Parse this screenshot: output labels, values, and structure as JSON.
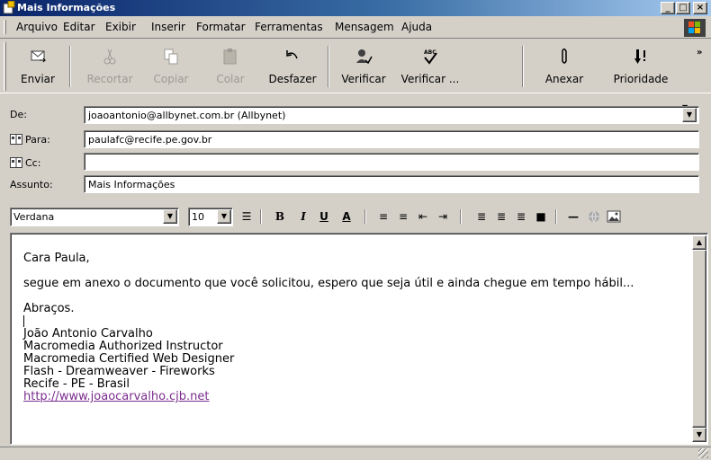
{
  "window": {
    "title": "Mais Informações",
    "controls": {
      "minimize": "_",
      "maximize": "□",
      "close": "×"
    }
  },
  "menu": [
    "Arquivo",
    "Editar",
    "Exibir",
    "Inserir",
    "Formatar",
    "Ferramentas",
    "Mensagem",
    "Ajuda"
  ],
  "toolbar": {
    "send": "Enviar",
    "cut": "Recortar",
    "copy": "Copiar",
    "paste": "Colar",
    "undo": "Desfazer",
    "check_names": "Verificar",
    "spelling": "Verificar ...",
    "attach": "Anexar",
    "priority": "Prioridade",
    "more": "»"
  },
  "header": {
    "from_label": "De:",
    "from_value": "joaoantonio@allbynet.com.br    (Allbynet)",
    "to_label": "Para:",
    "to_value": "paulafc@recife.pe.gov.br",
    "cc_label": "Cc:",
    "cc_value": "",
    "subject_label": "Assunto:",
    "subject_value": "Mais Informações"
  },
  "format": {
    "font": "Verdana",
    "size": "10",
    "bold": "B",
    "italic": "I",
    "underline": "U",
    "font_color": "A"
  },
  "body": {
    "greeting": "Cara Paula,",
    "paragraph": "segue em anexo o documento que você solicitou, espero que seja útil e ainda chegue em tempo hábil...",
    "closing": "Abraços.",
    "signature": [
      "João Antonio Carvalho",
      "Macromedia Authorized Instructor",
      "Macromedia Certified Web Designer",
      "Flash - Dreamweaver - Fireworks",
      "Recife - PE - Brasil"
    ],
    "link": "http://www.joaocarvalho.cjb.net"
  },
  "colors": {
    "title_start": "#0a246a",
    "title_end": "#a6caf0",
    "chrome": "#d4d0c8",
    "link": "#7b2d8e"
  }
}
